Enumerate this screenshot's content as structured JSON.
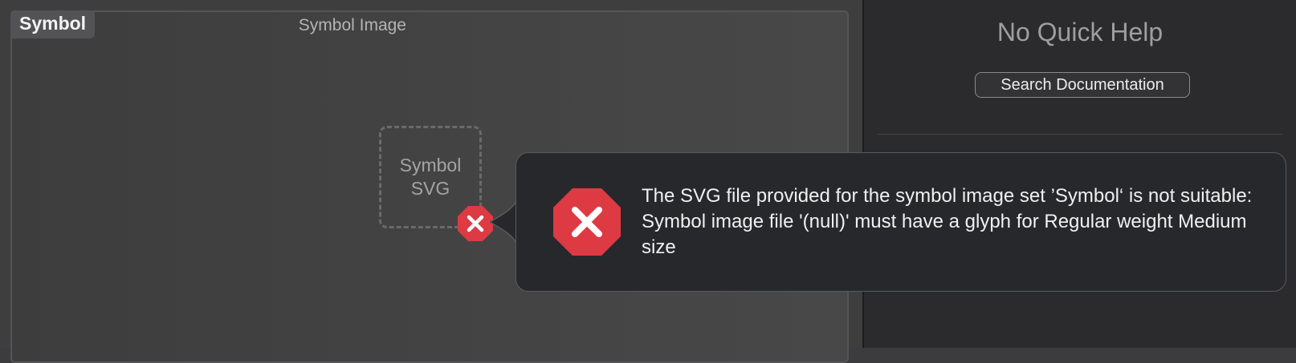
{
  "editor": {
    "set_name": "Symbol",
    "set_type": "Symbol Image",
    "slot_label_line1": "Symbol",
    "slot_label_line2": "SVG"
  },
  "inspector": {
    "title": "No Quick Help",
    "search_button": "Search Documentation"
  },
  "error_popover": {
    "message": "The SVG file provided for the symbol image set ’Symbol‘ is not suitable: Symbol image file '(null)' must have a glyph for Regular weight Medium size"
  },
  "icons": {
    "slot_error": "error-octagon-icon",
    "popover_error": "error-octagon-icon"
  },
  "colors": {
    "error_red": "#dd3a44",
    "popover_bg": "#27282b",
    "editor_bg": "#3e3e3e",
    "inspector_bg": "#2b2b2d"
  }
}
